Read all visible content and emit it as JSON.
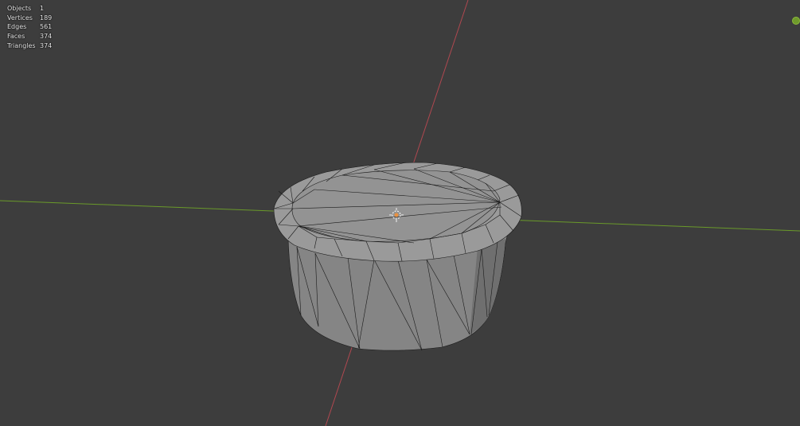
{
  "viewport": {
    "stats": [
      {
        "label": "Objects",
        "value": "1"
      },
      {
        "label": "Vertices",
        "value": "189"
      },
      {
        "label": "Edges",
        "value": "561"
      },
      {
        "label": "Faces",
        "value": "374"
      },
      {
        "label": "Triangles",
        "value": "374"
      }
    ]
  },
  "colors": {
    "background": "#3d3d3d",
    "x_axis": "#b04850",
    "y_axis": "#6a9a2a",
    "mesh_fill": "#8c8c8c",
    "wire": "#1a1a1a",
    "origin": "#e89040"
  }
}
